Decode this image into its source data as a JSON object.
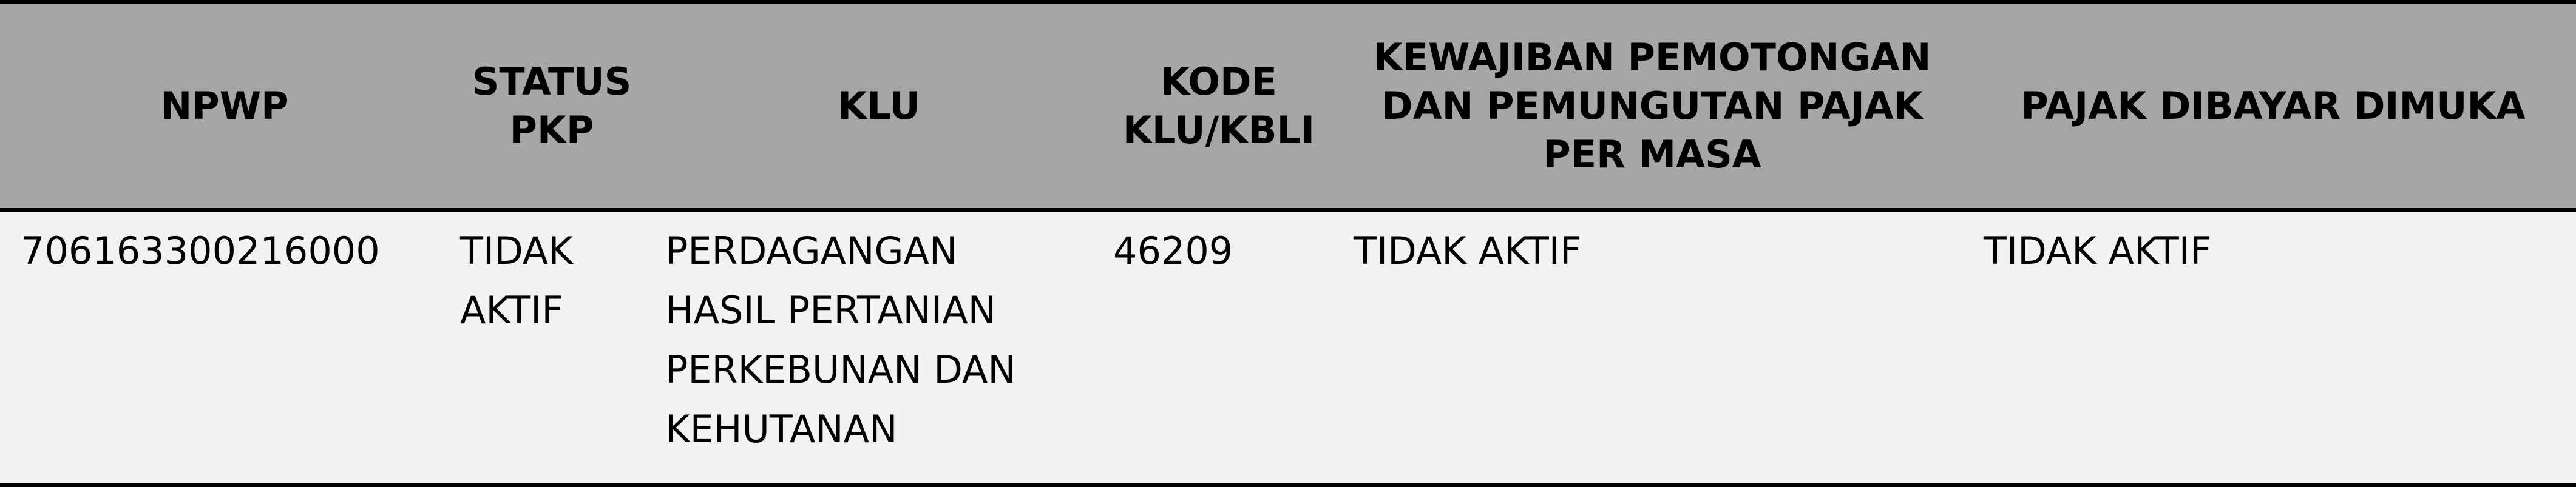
{
  "table": {
    "headers": [
      "NPWP",
      "STATUS\nPKP",
      "KLU",
      "KODE\nKLU/KBLI",
      "KEWAJIBAN PEMOTONGAN\nDAN PEMUNGUTAN PAJAK\nPER MASA",
      "PAJAK DIBAYAR DIMUKA"
    ],
    "rows": [
      [
        "706163300216000",
        "TIDAK\nAKTIF",
        "PERDAGANGAN\nHASIL PERTANIAN\nPERKEBUNAN DAN\nKEHUTANAN",
        "46209",
        "TIDAK AKTIF",
        "TIDAK AKTIF"
      ]
    ]
  },
  "colors": {
    "header_background": "#a6a6a6",
    "row_background": "#f2f2f2",
    "border": "#000000",
    "text": "#000000"
  }
}
